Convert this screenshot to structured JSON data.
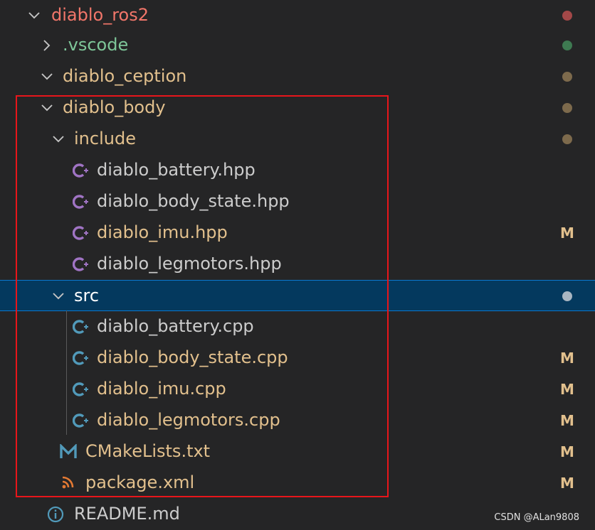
{
  "colors": {
    "background": "#252526",
    "selection": "#04395e",
    "selection_border": "#0a78d0",
    "chevron": "#c5c5c5",
    "red_text": "#f2766a",
    "green_text": "#7ec699",
    "modified_text": "#e2c08d",
    "default_text": "#cccccc",
    "cpp_icon": "#519aba",
    "hpp_icon": "#a074c4",
    "cmake_icon": "#519aba",
    "rss_icon": "#e37933",
    "info_icon": "#519aba",
    "highlight_box": "#e8161b"
  },
  "tree": [
    {
      "label": "diablo_ros2",
      "type": "folder",
      "expanded": true,
      "color": "#f2766a",
      "status": "dot",
      "status_color": "#a34848"
    },
    {
      "label": ".vscode",
      "type": "folder",
      "expanded": false,
      "color": "#7ec699",
      "status": "dot",
      "status_color": "#3e7a51"
    },
    {
      "label": "diablo_ception",
      "type": "folder",
      "expanded": true,
      "color": "#e2c08d",
      "status": "dot",
      "status_color": "#7d6a4c"
    },
    {
      "label": "diablo_body",
      "type": "folder",
      "expanded": true,
      "color": "#e2c08d",
      "status": "dot",
      "status_color": "#7d6a4c"
    },
    {
      "label": "include",
      "type": "folder",
      "expanded": true,
      "color": "#e2c08d",
      "status": "dot",
      "status_color": "#7d6a4c"
    },
    {
      "label": "diablo_battery.hpp",
      "type": "hpp",
      "color": "#cccccc",
      "status": ""
    },
    {
      "label": "diablo_body_state.hpp",
      "type": "hpp",
      "color": "#cccccc",
      "status": ""
    },
    {
      "label": "diablo_imu.hpp",
      "type": "hpp",
      "color": "#e2c08d",
      "status": "M",
      "status_color": "#e2c08d"
    },
    {
      "label": "diablo_legmotors.hpp",
      "type": "hpp",
      "color": "#cccccc",
      "status": ""
    },
    {
      "label": "src",
      "type": "folder",
      "expanded": true,
      "color": "#ffffff",
      "status": "dot",
      "status_color": "#a9b6c2",
      "selected": true
    },
    {
      "label": "diablo_battery.cpp",
      "type": "cpp",
      "color": "#cccccc",
      "status": ""
    },
    {
      "label": "diablo_body_state.cpp",
      "type": "cpp",
      "color": "#e2c08d",
      "status": "M",
      "status_color": "#e2c08d"
    },
    {
      "label": "diablo_imu.cpp",
      "type": "cpp",
      "color": "#e2c08d",
      "status": "M",
      "status_color": "#e2c08d"
    },
    {
      "label": "diablo_legmotors.cpp",
      "type": "cpp",
      "color": "#e2c08d",
      "status": "M",
      "status_color": "#e2c08d"
    },
    {
      "label": "CMakeLists.txt",
      "type": "cmake",
      "color": "#e2c08d",
      "status": "M",
      "status_color": "#e2c08d"
    },
    {
      "label": "package.xml",
      "type": "rss",
      "color": "#e2c08d",
      "status": "M",
      "status_color": "#e2c08d"
    },
    {
      "label": "README.md",
      "type": "info",
      "color": "#cccccc",
      "status": ""
    }
  ],
  "watermark": "CSDN @ALan9808"
}
